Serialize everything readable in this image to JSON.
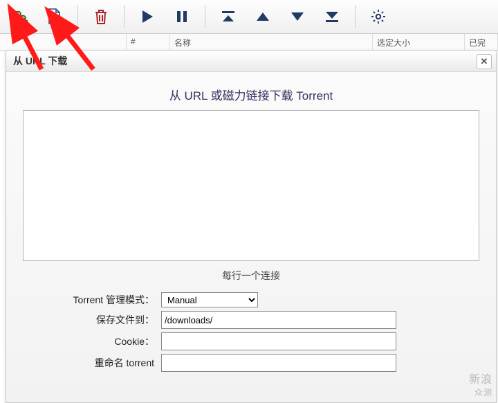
{
  "toolbar": {
    "add_link_tip": "add-link",
    "add_file_tip": "add-file",
    "delete_tip": "delete",
    "start_tip": "start",
    "pause_tip": "pause",
    "move_top_tip": "top",
    "move_up_tip": "up",
    "move_down_tip": "down",
    "move_bottom_tip": "bottom",
    "settings_tip": "settings"
  },
  "table": {
    "col_index": "#",
    "col_name": "名称",
    "col_size": "选定大小",
    "col_done": "已完"
  },
  "dialog": {
    "title": "从 URL 下载",
    "heading": "从 URL 或磁力链接下载 Torrent",
    "textarea_value": "",
    "hint": "每行一个连接",
    "labels": {
      "manage_mode": "Torrent 管理模式：",
      "save_to": "保存文件到：",
      "cookie": "Cookie：",
      "rename": "重命名 torrent"
    },
    "mode_options": [
      "Manual"
    ],
    "mode_value": "Manual",
    "save_path": "/downloads/"
  },
  "watermark": {
    "line1": "新浪",
    "line2": "众测"
  }
}
